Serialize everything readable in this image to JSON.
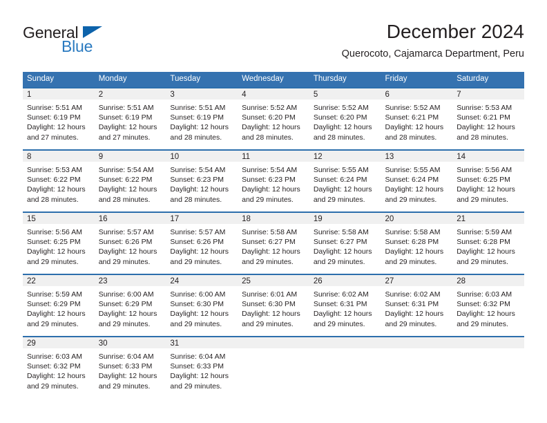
{
  "brand": {
    "name_part1": "General",
    "name_part2": "Blue",
    "triangle_color": "#0d63ab",
    "blue_color": "#2a7ac0"
  },
  "header": {
    "title": "December 2024",
    "subtitle": "Querocoto, Cajamarca Department, Peru"
  },
  "theme": {
    "header_blue": "#3572b0",
    "divider_blue": "#2c6eac",
    "daynum_band": "#f0f0f0",
    "text": "#231f20"
  },
  "weekday_headers": [
    "Sunday",
    "Monday",
    "Tuesday",
    "Wednesday",
    "Thursday",
    "Friday",
    "Saturday"
  ],
  "labels": {
    "sunrise_prefix": "Sunrise:",
    "sunset_prefix": "Sunset:",
    "daylight_prefix": "Daylight:"
  },
  "weeks": [
    [
      {
        "day": "1",
        "line1": "Sunrise: 5:51 AM",
        "line2": "Sunset: 6:19 PM",
        "line3": "Daylight: 12 hours",
        "line4": "and 27 minutes."
      },
      {
        "day": "2",
        "line1": "Sunrise: 5:51 AM",
        "line2": "Sunset: 6:19 PM",
        "line3": "Daylight: 12 hours",
        "line4": "and 27 minutes."
      },
      {
        "day": "3",
        "line1": "Sunrise: 5:51 AM",
        "line2": "Sunset: 6:19 PM",
        "line3": "Daylight: 12 hours",
        "line4": "and 28 minutes."
      },
      {
        "day": "4",
        "line1": "Sunrise: 5:52 AM",
        "line2": "Sunset: 6:20 PM",
        "line3": "Daylight: 12 hours",
        "line4": "and 28 minutes."
      },
      {
        "day": "5",
        "line1": "Sunrise: 5:52 AM",
        "line2": "Sunset: 6:20 PM",
        "line3": "Daylight: 12 hours",
        "line4": "and 28 minutes."
      },
      {
        "day": "6",
        "line1": "Sunrise: 5:52 AM",
        "line2": "Sunset: 6:21 PM",
        "line3": "Daylight: 12 hours",
        "line4": "and 28 minutes."
      },
      {
        "day": "7",
        "line1": "Sunrise: 5:53 AM",
        "line2": "Sunset: 6:21 PM",
        "line3": "Daylight: 12 hours",
        "line4": "and 28 minutes."
      }
    ],
    [
      {
        "day": "8",
        "line1": "Sunrise: 5:53 AM",
        "line2": "Sunset: 6:22 PM",
        "line3": "Daylight: 12 hours",
        "line4": "and 28 minutes."
      },
      {
        "day": "9",
        "line1": "Sunrise: 5:54 AM",
        "line2": "Sunset: 6:22 PM",
        "line3": "Daylight: 12 hours",
        "line4": "and 28 minutes."
      },
      {
        "day": "10",
        "line1": "Sunrise: 5:54 AM",
        "line2": "Sunset: 6:23 PM",
        "line3": "Daylight: 12 hours",
        "line4": "and 28 minutes."
      },
      {
        "day": "11",
        "line1": "Sunrise: 5:54 AM",
        "line2": "Sunset: 6:23 PM",
        "line3": "Daylight: 12 hours",
        "line4": "and 29 minutes."
      },
      {
        "day": "12",
        "line1": "Sunrise: 5:55 AM",
        "line2": "Sunset: 6:24 PM",
        "line3": "Daylight: 12 hours",
        "line4": "and 29 minutes."
      },
      {
        "day": "13",
        "line1": "Sunrise: 5:55 AM",
        "line2": "Sunset: 6:24 PM",
        "line3": "Daylight: 12 hours",
        "line4": "and 29 minutes."
      },
      {
        "day": "14",
        "line1": "Sunrise: 5:56 AM",
        "line2": "Sunset: 6:25 PM",
        "line3": "Daylight: 12 hours",
        "line4": "and 29 minutes."
      }
    ],
    [
      {
        "day": "15",
        "line1": "Sunrise: 5:56 AM",
        "line2": "Sunset: 6:25 PM",
        "line3": "Daylight: 12 hours",
        "line4": "and 29 minutes."
      },
      {
        "day": "16",
        "line1": "Sunrise: 5:57 AM",
        "line2": "Sunset: 6:26 PM",
        "line3": "Daylight: 12 hours",
        "line4": "and 29 minutes."
      },
      {
        "day": "17",
        "line1": "Sunrise: 5:57 AM",
        "line2": "Sunset: 6:26 PM",
        "line3": "Daylight: 12 hours",
        "line4": "and 29 minutes."
      },
      {
        "day": "18",
        "line1": "Sunrise: 5:58 AM",
        "line2": "Sunset: 6:27 PM",
        "line3": "Daylight: 12 hours",
        "line4": "and 29 minutes."
      },
      {
        "day": "19",
        "line1": "Sunrise: 5:58 AM",
        "line2": "Sunset: 6:27 PM",
        "line3": "Daylight: 12 hours",
        "line4": "and 29 minutes."
      },
      {
        "day": "20",
        "line1": "Sunrise: 5:58 AM",
        "line2": "Sunset: 6:28 PM",
        "line3": "Daylight: 12 hours",
        "line4": "and 29 minutes."
      },
      {
        "day": "21",
        "line1": "Sunrise: 5:59 AM",
        "line2": "Sunset: 6:28 PM",
        "line3": "Daylight: 12 hours",
        "line4": "and 29 minutes."
      }
    ],
    [
      {
        "day": "22",
        "line1": "Sunrise: 5:59 AM",
        "line2": "Sunset: 6:29 PM",
        "line3": "Daylight: 12 hours",
        "line4": "and 29 minutes."
      },
      {
        "day": "23",
        "line1": "Sunrise: 6:00 AM",
        "line2": "Sunset: 6:29 PM",
        "line3": "Daylight: 12 hours",
        "line4": "and 29 minutes."
      },
      {
        "day": "24",
        "line1": "Sunrise: 6:00 AM",
        "line2": "Sunset: 6:30 PM",
        "line3": "Daylight: 12 hours",
        "line4": "and 29 minutes."
      },
      {
        "day": "25",
        "line1": "Sunrise: 6:01 AM",
        "line2": "Sunset: 6:30 PM",
        "line3": "Daylight: 12 hours",
        "line4": "and 29 minutes."
      },
      {
        "day": "26",
        "line1": "Sunrise: 6:02 AM",
        "line2": "Sunset: 6:31 PM",
        "line3": "Daylight: 12 hours",
        "line4": "and 29 minutes."
      },
      {
        "day": "27",
        "line1": "Sunrise: 6:02 AM",
        "line2": "Sunset: 6:31 PM",
        "line3": "Daylight: 12 hours",
        "line4": "and 29 minutes."
      },
      {
        "day": "28",
        "line1": "Sunrise: 6:03 AM",
        "line2": "Sunset: 6:32 PM",
        "line3": "Daylight: 12 hours",
        "line4": "and 29 minutes."
      }
    ],
    [
      {
        "day": "29",
        "line1": "Sunrise: 6:03 AM",
        "line2": "Sunset: 6:32 PM",
        "line3": "Daylight: 12 hours",
        "line4": "and 29 minutes."
      },
      {
        "day": "30",
        "line1": "Sunrise: 6:04 AM",
        "line2": "Sunset: 6:33 PM",
        "line3": "Daylight: 12 hours",
        "line4": "and 29 minutes."
      },
      {
        "day": "31",
        "line1": "Sunrise: 6:04 AM",
        "line2": "Sunset: 6:33 PM",
        "line3": "Daylight: 12 hours",
        "line4": "and 29 minutes."
      },
      {
        "day": "",
        "line1": "",
        "line2": "",
        "line3": "",
        "line4": ""
      },
      {
        "day": "",
        "line1": "",
        "line2": "",
        "line3": "",
        "line4": ""
      },
      {
        "day": "",
        "line1": "",
        "line2": "",
        "line3": "",
        "line4": ""
      },
      {
        "day": "",
        "line1": "",
        "line2": "",
        "line3": "",
        "line4": ""
      }
    ]
  ]
}
